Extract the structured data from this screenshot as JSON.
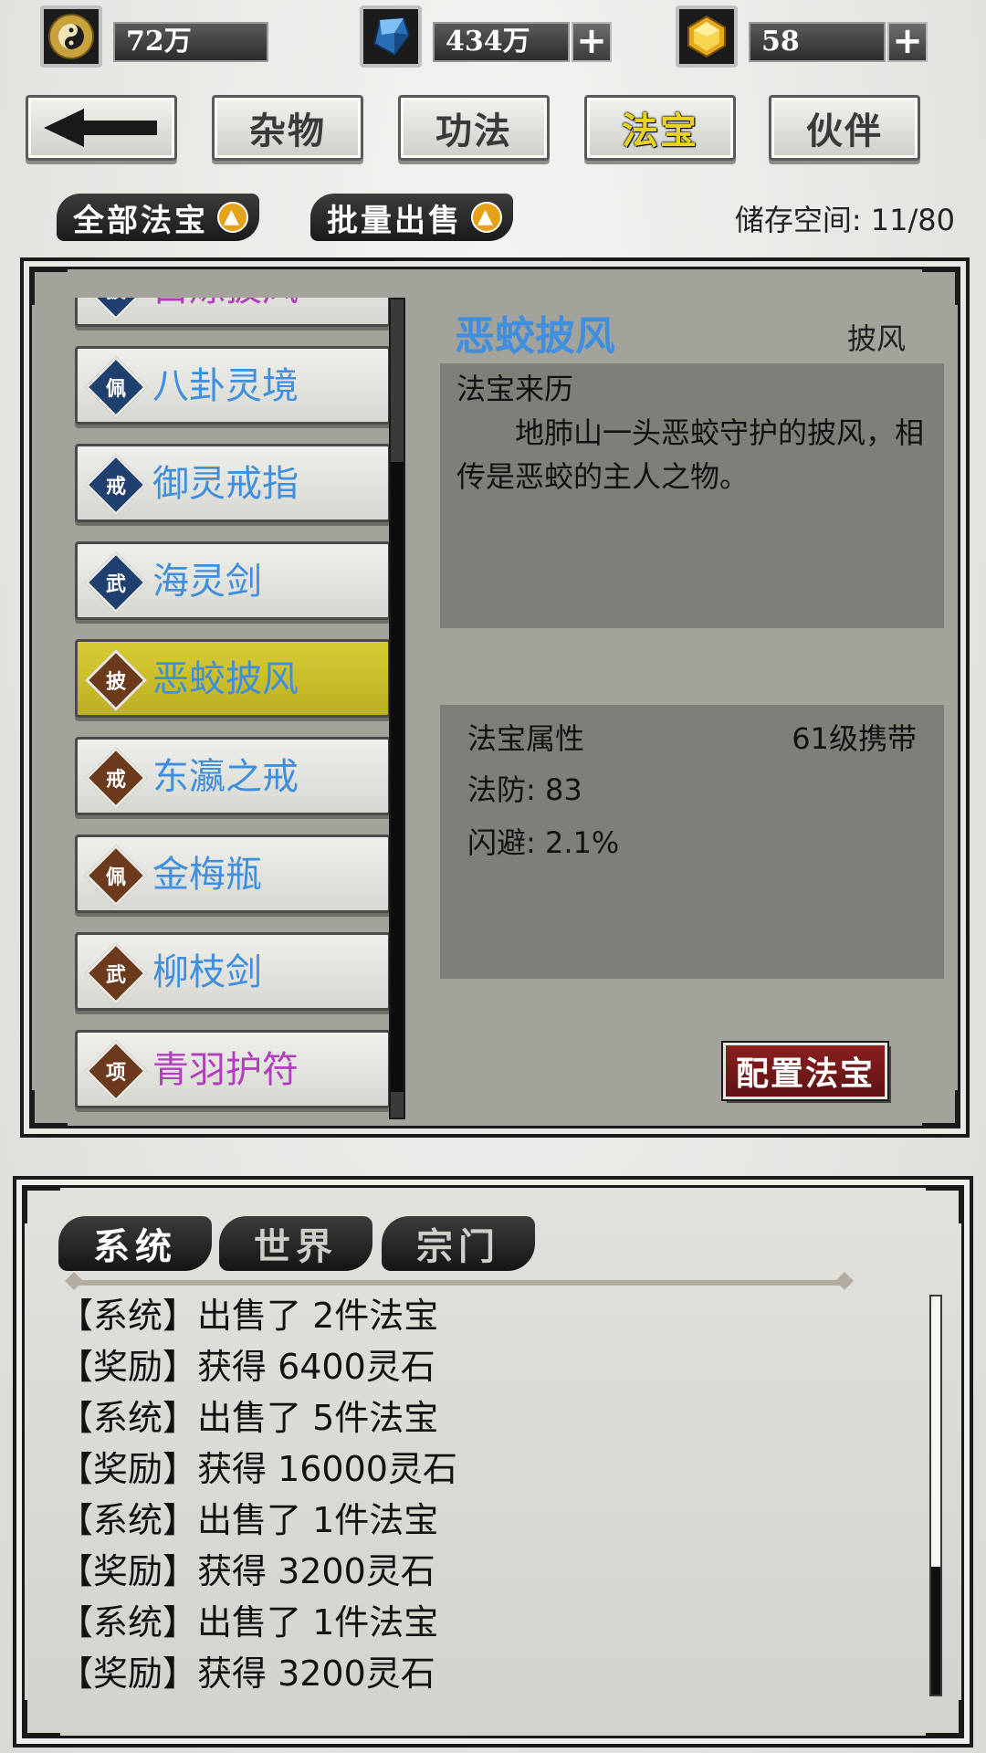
{
  "resources": [
    {
      "icon": "yin-yang-icon",
      "value": "72万",
      "has_plus": false
    },
    {
      "icon": "blue-crystal-icon",
      "value": "434万",
      "has_plus": true
    },
    {
      "icon": "gold-gem-icon",
      "value": "58",
      "has_plus": true
    }
  ],
  "nav": {
    "back_icon": "back-arrow-icon",
    "tabs": [
      "杂物",
      "功法",
      "法宝",
      "伙伴"
    ],
    "active_tab": "法宝"
  },
  "toolbar": {
    "filter_label": "全部法宝",
    "sell_label": "批量出售",
    "storage_label": "储存空间: 11/80"
  },
  "items": [
    {
      "badge": "披",
      "name": "白炼披风",
      "name_color": "purple",
      "badge_color": "blue",
      "selected": false
    },
    {
      "badge": "佩",
      "name": "八卦灵境",
      "name_color": "blue",
      "badge_color": "blue",
      "selected": false
    },
    {
      "badge": "戒",
      "name": "御灵戒指",
      "name_color": "blue",
      "badge_color": "blue",
      "selected": false
    },
    {
      "badge": "武",
      "name": "海灵剑",
      "name_color": "blue",
      "badge_color": "blue",
      "selected": false
    },
    {
      "badge": "披",
      "name": "恶蛟披风",
      "name_color": "blue",
      "badge_color": "brown",
      "selected": true
    },
    {
      "badge": "戒",
      "name": "东瀛之戒",
      "name_color": "blue",
      "badge_color": "brown",
      "selected": false
    },
    {
      "badge": "佩",
      "name": "金梅瓶",
      "name_color": "blue",
      "badge_color": "brown",
      "selected": false
    },
    {
      "badge": "武",
      "name": "柳枝剑",
      "name_color": "blue",
      "badge_color": "brown",
      "selected": false
    },
    {
      "badge": "项",
      "name": "青羽护符",
      "name_color": "purple",
      "badge_color": "brown",
      "selected": false
    }
  ],
  "detail": {
    "title": "恶蛟披风",
    "type": "披风",
    "origin_heading": "法宝来历",
    "origin_text": "地肺山一头恶蛟守护的披风，相传是恶蛟的主人之物。",
    "attr_heading": "法宝属性",
    "level_req": "61级携带",
    "stats": [
      "法防: 83",
      "闪避: 2.1%"
    ],
    "equip_label": "配置法宝"
  },
  "chat": {
    "tabs": [
      "系统",
      "世界",
      "宗门"
    ],
    "messages": [
      "【系统】出售了 2件法宝",
      "【奖励】获得 6400灵石",
      "【系统】出售了 5件法宝",
      "【奖励】获得 16000灵石",
      "【系统】出售了 1件法宝",
      "【奖励】获得 3200灵石",
      "【系统】出售了 1件法宝",
      "【奖励】获得 3200灵石"
    ]
  },
  "colors": {
    "item_name_blue": "#3f8fde",
    "item_name_purple": "#b43cbf",
    "selected_item": "#d8cc34",
    "active_tab_text": "#e8d420",
    "equip_button": "#8a1f1f"
  }
}
